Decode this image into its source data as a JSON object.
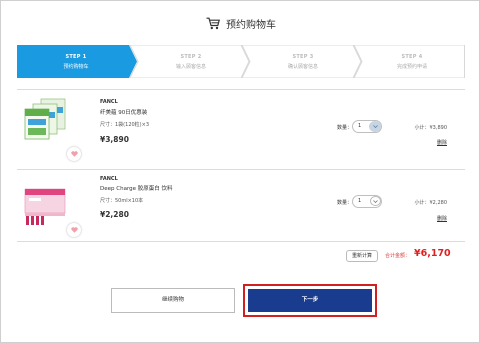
{
  "header": {
    "title": "预约购物车",
    "cart_icon": "shopping-cart-icon"
  },
  "steps": [
    {
      "number": "STEP 1",
      "label": "预约购物车",
      "active": true
    },
    {
      "number": "STEP 2",
      "label": "输入顾客信息",
      "active": false
    },
    {
      "number": "STEP 3",
      "label": "确认顾客信息",
      "active": false
    },
    {
      "number": "STEP 4",
      "label": "完成预约申请",
      "active": false
    }
  ],
  "colors": {
    "step_active": "#1a9ae0",
    "step_inactive": "#ffffff",
    "next_button": "#1a3c8e",
    "highlight": "#d21f1f",
    "total": "#e02020"
  },
  "products": [
    {
      "brand": "FANCL",
      "name": "纤美藴 90日优惠装",
      "spec": "尺寸：1袋(120粒)×3",
      "price": "¥3,890",
      "qty_label": "数量：",
      "qty": "1",
      "subtotal": "小计：¥3,890",
      "delete": "删除"
    },
    {
      "brand": "FANCL",
      "name": "Deep Charge 胶原蛋白 饮料",
      "spec": "尺寸：50ml×10本",
      "price": "¥2,280",
      "qty_label": "数量：",
      "qty": "1",
      "subtotal": "小计：¥2,280",
      "delete": "删除"
    }
  ],
  "summary": {
    "recalc": "重新计算",
    "total_label": "合计金额：",
    "total_value": "¥6,170"
  },
  "buttons": {
    "continue": "继续购物",
    "next": "下一步"
  }
}
